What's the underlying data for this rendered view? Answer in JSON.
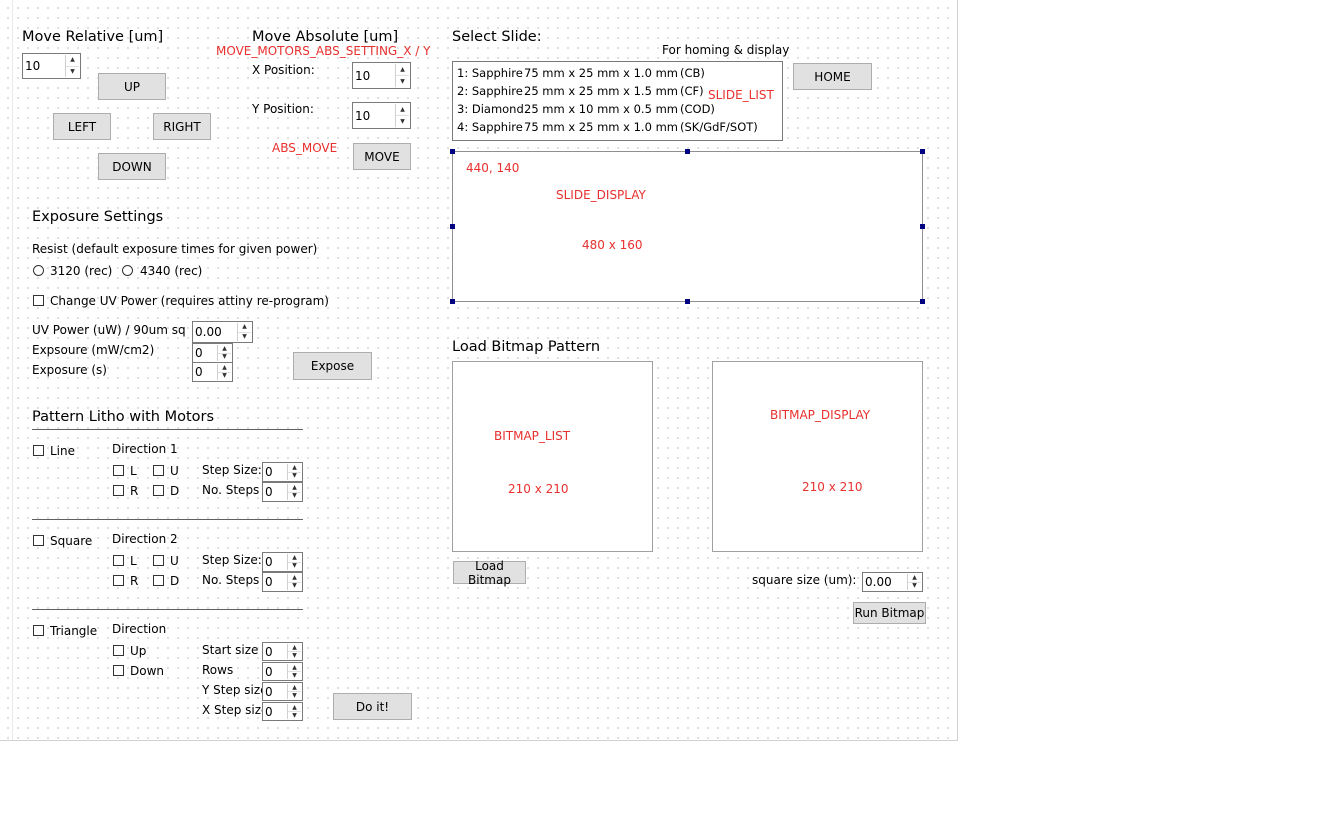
{
  "move_relative": {
    "title": "Move Relative [um]",
    "step_value": "10",
    "up": "UP",
    "left": "LEFT",
    "right": "RIGHT",
    "down": "DOWN"
  },
  "move_absolute": {
    "title": "Move Absolute [um]",
    "setting_tag": "MOVE_MOTORS_ABS_SETTING_X / Y",
    "x_label": "X Position:",
    "x_value": "10",
    "y_label": "Y Position:",
    "y_value": "10",
    "abs_tag": "ABS_MOVE",
    "move": "MOVE"
  },
  "select_slide": {
    "title": "Select Slide:",
    "note": "For homing & display",
    "list_tag": "SLIDE_LIST",
    "items": [
      {
        "name": "1: Sapphire",
        "dims": "75 mm x 25 mm x 1.0 mm",
        "code": "(CB)"
      },
      {
        "name": "2: Sapphire",
        "dims": "25 mm x 25 mm x 1.5 mm",
        "code": "(CF)"
      },
      {
        "name": "3: Diamond",
        "dims": "25 mm x 10 mm x 0.5 mm",
        "code": "(COD)"
      },
      {
        "name": "4: Sapphire",
        "dims": "75 mm x 25 mm x 1.0 mm",
        "code": "(SK/GdF/SOT)"
      }
    ],
    "home": "HOME"
  },
  "slide_display": {
    "coords": "440, 140",
    "tag": "SLIDE_DISPLAY",
    "size": "480 x 160"
  },
  "exposure": {
    "title": "Exposure Settings",
    "resist_label": "Resist (default exposure times for given power)",
    "radio1": "3120 (rec)",
    "radio2": "4340 (rec)",
    "change_uv": "Change UV Power (requires attiny re-program)",
    "uv_power_label": "UV Power (uW) / 90um sq",
    "uv_power_value": "0.00",
    "exposure_mw_label": "Expsoure (mW/cm2)",
    "exposure_mw_value": "0",
    "exposure_s_label": "Exposure (s)",
    "exposure_s_value": "0",
    "expose": "Expose"
  },
  "pattern": {
    "title": "Pattern Litho with Motors",
    "line": {
      "label": "Line",
      "direction": "Direction 1",
      "l": "L",
      "u": "U",
      "r": "R",
      "d": "D",
      "step_size_label": "Step Size:",
      "step_size": "0",
      "steps_label": "No. Steps",
      "steps": "0"
    },
    "square": {
      "label": "Square",
      "direction": "Direction 2",
      "l": "L",
      "u": "U",
      "r": "R",
      "d": "D",
      "step_size_label": "Step Size:",
      "step_size": "0",
      "steps_label": "No. Steps",
      "steps": "0"
    },
    "triangle": {
      "label": "Triangle",
      "direction": "Direction",
      "up": "Up",
      "down": "Down",
      "start_label": "Start size",
      "start": "0",
      "rows_label": "Rows",
      "rows": "0",
      "ystep_label": "Y Step size",
      "ystep": "0",
      "xstep_label": "X Step size",
      "xstep": "0"
    },
    "do_it": "Do it!"
  },
  "bitmap": {
    "title": "Load Bitmap Pattern",
    "list_tag": "BITMAP_LIST",
    "list_size": "210 x 210",
    "display_tag": "BITMAP_DISPLAY",
    "display_size": "210 x 210",
    "load": "Load Bitmap",
    "square_label": "square size (um):",
    "square_value": "0.00",
    "run": "Run Bitmap"
  }
}
